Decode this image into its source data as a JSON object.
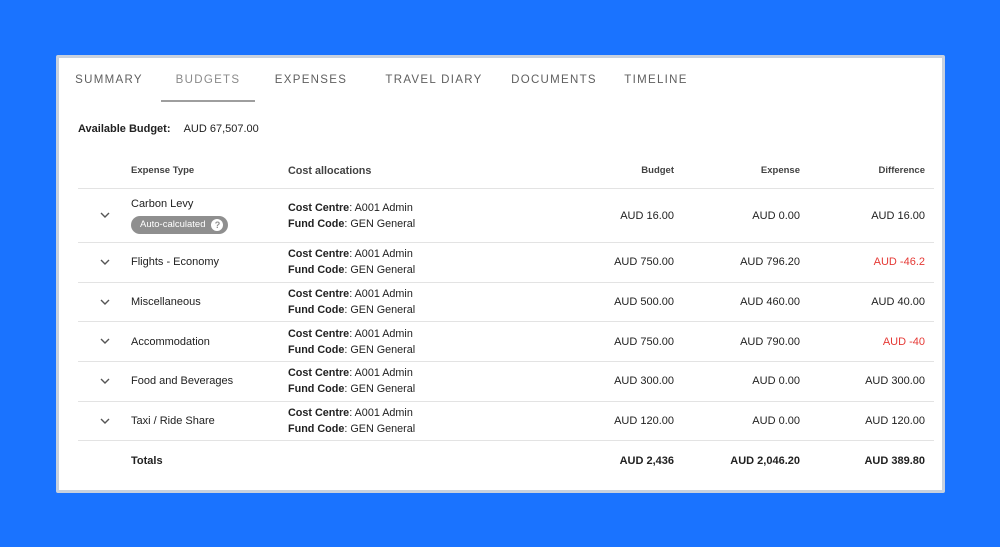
{
  "tabs": [
    {
      "label": "SUMMARY"
    },
    {
      "label": "BUDGETS"
    },
    {
      "label": "EXPENSES"
    },
    {
      "label": "TRAVEL DIARY"
    },
    {
      "label": "DOCUMENTS"
    },
    {
      "label": "TIMELINE"
    }
  ],
  "active_tab": "BUDGETS",
  "available_budget": {
    "label": "Available Budget:",
    "value": "AUD 67,507.00"
  },
  "table": {
    "headers": {
      "expense_type": "Expense Type",
      "cost_allocations": "Cost allocations",
      "budget": "Budget",
      "expense": "Expense",
      "difference": "Difference"
    },
    "cost_centre_label": "Cost Centre",
    "fund_code_label": "Fund Code",
    "rows": [
      {
        "type": "Carbon Levy",
        "badge": "Auto-calculated",
        "cost_centre": ": A001 Admin",
        "fund_code": ": GEN General",
        "budget": "AUD 16.00",
        "expense": "AUD 0.00",
        "difference": "AUD 16.00"
      },
      {
        "type": "Flights - Economy",
        "cost_centre": ": A001 Admin",
        "fund_code": ": GEN General",
        "budget": "AUD 750.00",
        "expense": "AUD 796.20",
        "difference": "AUD -46.2"
      },
      {
        "type": "Miscellaneous",
        "cost_centre": ": A001 Admin",
        "fund_code": ": GEN General",
        "budget": "AUD 500.00",
        "expense": "AUD 460.00",
        "difference": "AUD 40.00"
      },
      {
        "type": "Accommodation",
        "cost_centre": ": A001 Admin",
        "fund_code": ": GEN General",
        "budget": "AUD 750.00",
        "expense": "AUD 790.00",
        "difference": "AUD -40"
      },
      {
        "type": "Food and Beverages",
        "cost_centre": ": A001 Admin",
        "fund_code": ": GEN General",
        "budget": "AUD 300.00",
        "expense": "AUD 0.00",
        "difference": "AUD 300.00"
      },
      {
        "type": "Taxi / Ride Share",
        "cost_centre": ": A001 Admin",
        "fund_code": ": GEN General",
        "budget": "AUD 120.00",
        "expense": "AUD 0.00",
        "difference": "AUD 120.00"
      }
    ],
    "totals": {
      "label": "Totals",
      "budget": "AUD 2,436",
      "expense": "AUD 2,046.20",
      "difference": "AUD 389.80"
    }
  },
  "icons": {
    "expand": "chevron-down-icon",
    "help": "help-circle-icon"
  },
  "colors": {
    "background": "#1a73ff",
    "negative": "#e53935",
    "badge": "#8f8f8f"
  }
}
